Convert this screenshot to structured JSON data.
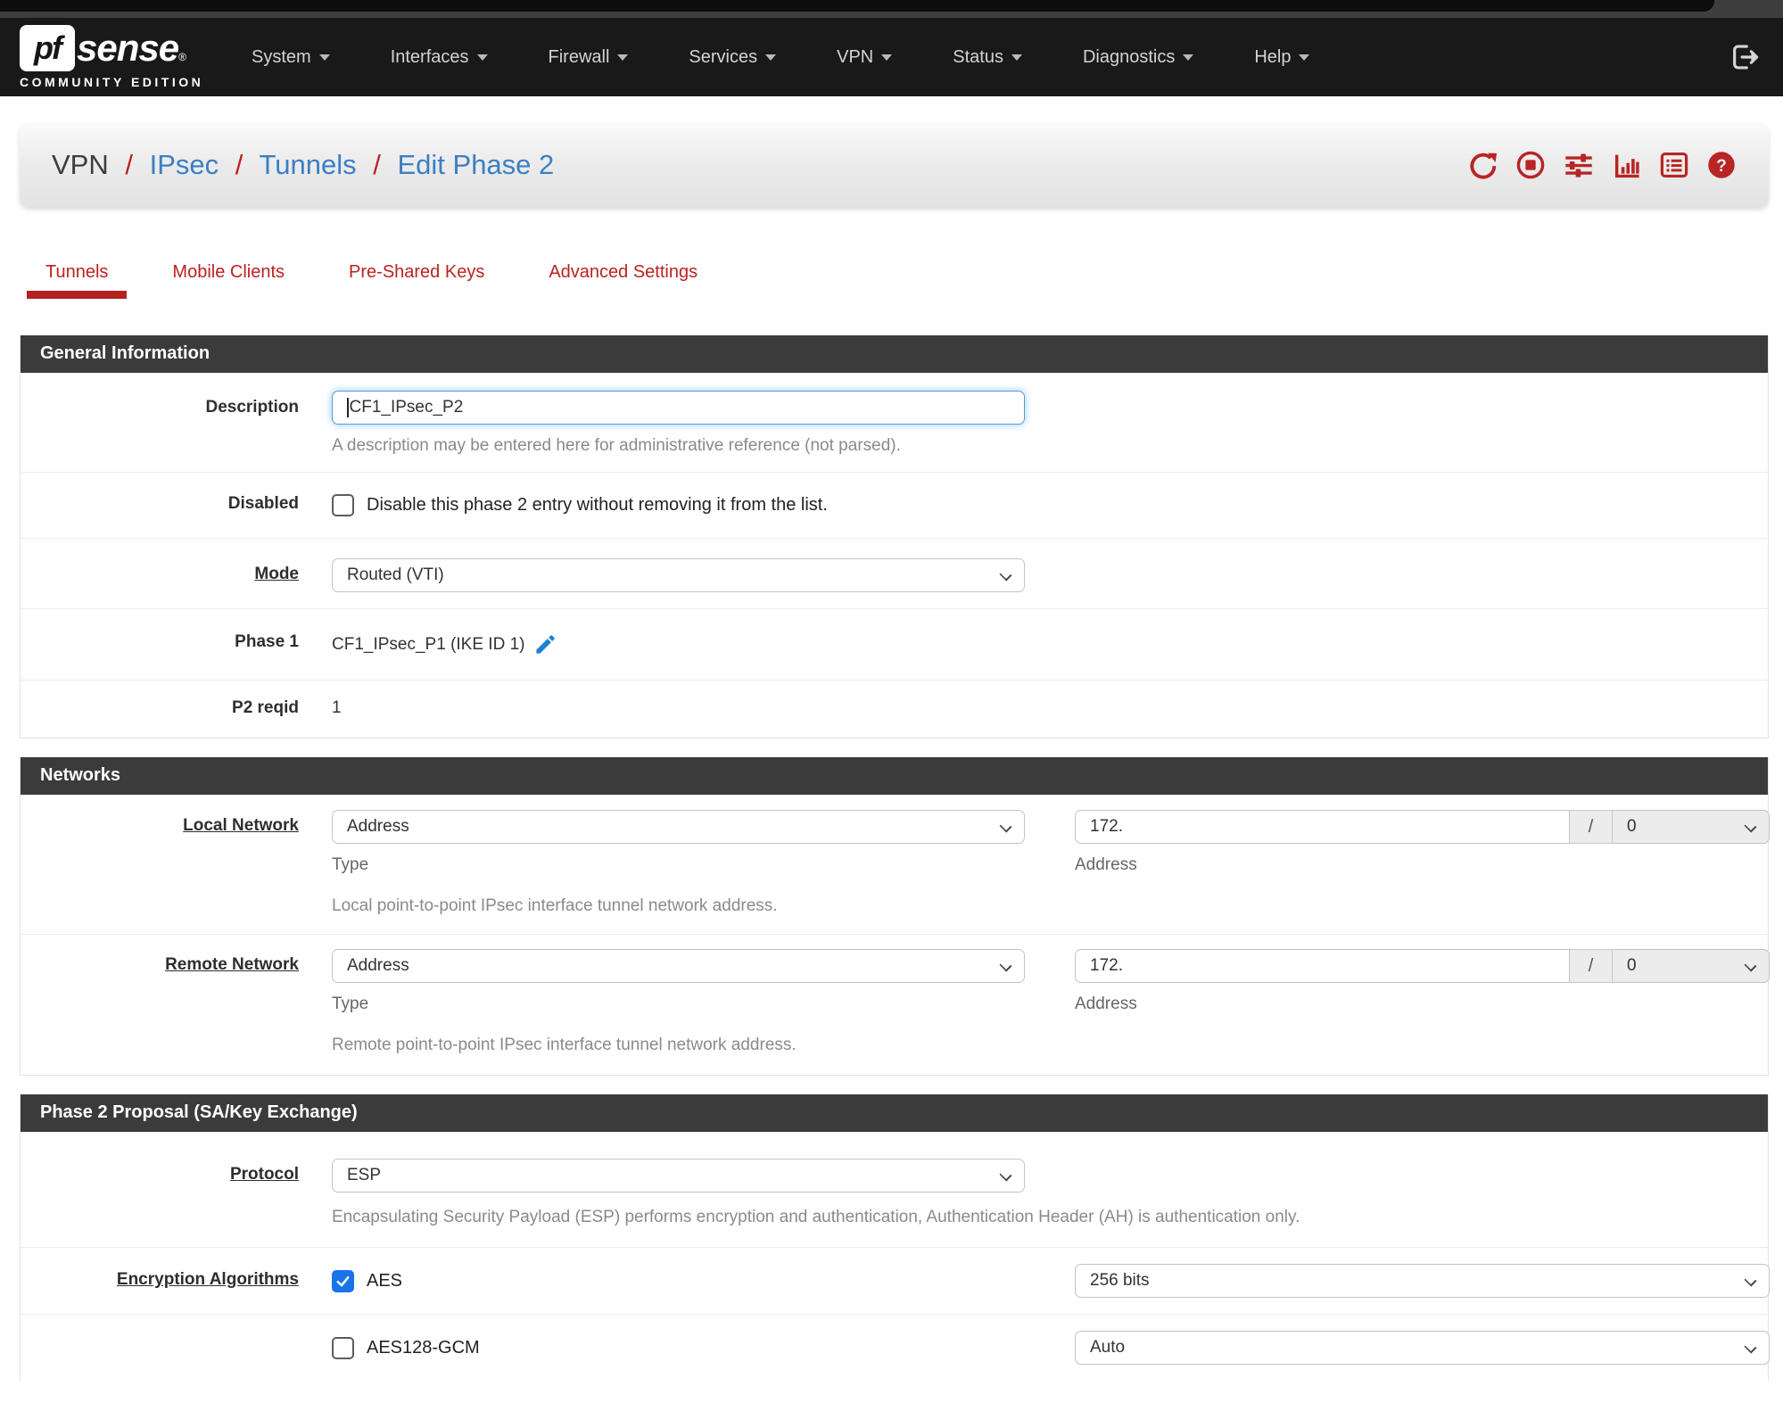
{
  "navbar": {
    "brand": {
      "pf": "pf",
      "sense": "sense",
      "reg": "®",
      "edition": "COMMUNITY EDITION"
    },
    "items": [
      {
        "label": "System"
      },
      {
        "label": "Interfaces"
      },
      {
        "label": "Firewall"
      },
      {
        "label": "Services"
      },
      {
        "label": "VPN"
      },
      {
        "label": "Status"
      },
      {
        "label": "Diagnostics"
      },
      {
        "label": "Help"
      }
    ]
  },
  "breadcrumb": {
    "root": "VPN",
    "sep": "/",
    "link1": "IPsec",
    "link2": "Tunnels",
    "link3": "Edit Phase 2"
  },
  "tabs": [
    {
      "label": "Tunnels",
      "active": true
    },
    {
      "label": "Mobile Clients",
      "active": false
    },
    {
      "label": "Pre-Shared Keys",
      "active": false
    },
    {
      "label": "Advanced Settings",
      "active": false
    }
  ],
  "general": {
    "title": "General Information",
    "description": {
      "label": "Description",
      "value": "CF1_IPsec_P2",
      "help": "A description may be entered here for administrative reference (not parsed)."
    },
    "disabled": {
      "label": "Disabled",
      "checkbox_label": "Disable this phase 2 entry without removing it from the list.",
      "checked": false
    },
    "mode": {
      "label": "Mode",
      "value": "Routed (VTI)"
    },
    "phase1": {
      "label": "Phase 1",
      "value": "CF1_IPsec_P1 (IKE ID 1)"
    },
    "p2reqid": {
      "label": "P2 reqid",
      "value": "1"
    }
  },
  "networks": {
    "title": "Networks",
    "local": {
      "label": "Local Network",
      "type_value": "Address",
      "type_caption": "Type",
      "address_value": "172.",
      "slash": "/",
      "mask_value": "0",
      "address_caption": "Address",
      "help": "Local point-to-point IPsec interface tunnel network address."
    },
    "remote": {
      "label": "Remote Network",
      "type_value": "Address",
      "type_caption": "Type",
      "address_value": "172.",
      "slash": "/",
      "mask_value": "0",
      "address_caption": "Address",
      "help": "Remote point-to-point IPsec interface tunnel network address."
    }
  },
  "proposal": {
    "title": "Phase 2 Proposal (SA/Key Exchange)",
    "protocol": {
      "label": "Protocol",
      "value": "ESP",
      "help": "Encapsulating Security Payload (ESP) performs encryption and authentication, Authentication Header (AH) is authentication only."
    },
    "encryption": {
      "label": "Encryption Algorithms",
      "algorithms": [
        {
          "name": "AES",
          "checked": true,
          "keylen": "256 bits"
        },
        {
          "name": "AES128-GCM",
          "checked": false,
          "keylen": "Auto"
        }
      ]
    }
  },
  "colors": {
    "accent_red": "#bb2222",
    "link_blue": "#3b7fc4",
    "checkbox_blue": "#1a73e8",
    "header_dark": "#3b3b3b",
    "navbar_dark": "#191919"
  }
}
